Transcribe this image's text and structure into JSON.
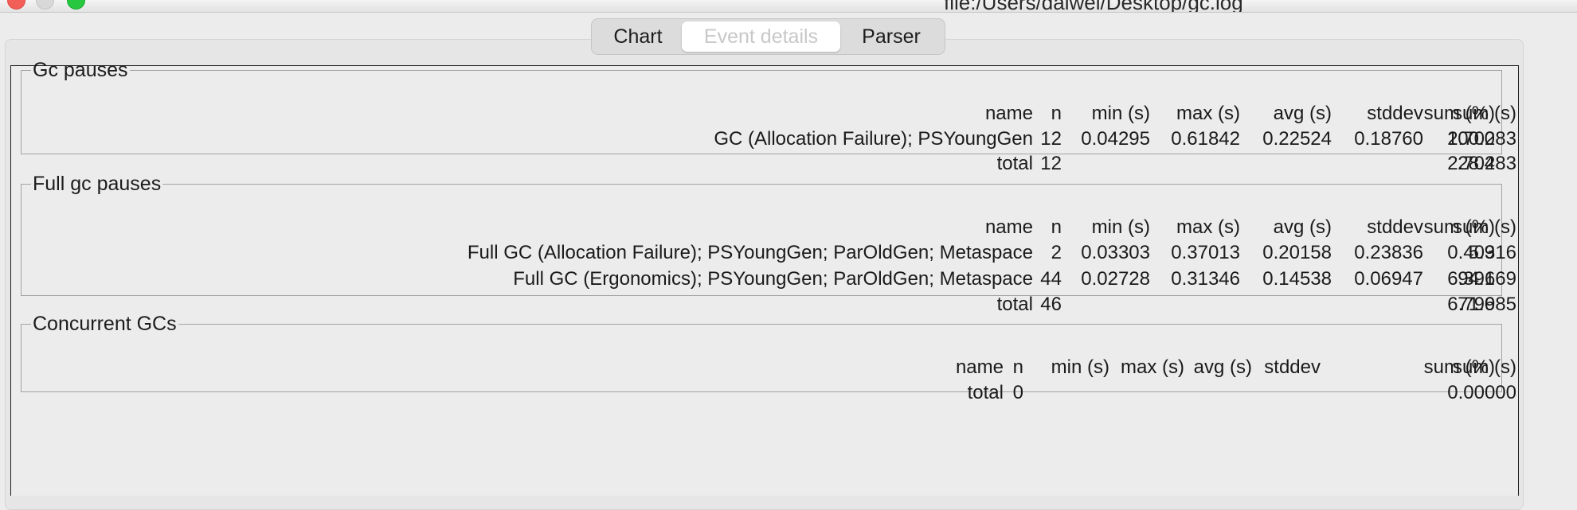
{
  "window": {
    "title": "file:/Users/daiwei/Desktop/gc.log"
  },
  "tabs": [
    "Chart",
    "Event details",
    "Parser"
  ],
  "selected_tab": "Event details",
  "columns": [
    "name",
    "n",
    "min (s)",
    "max (s)",
    "avg (s)",
    "stddev",
    "sum (s)",
    "sum (%)"
  ],
  "gc_pauses": {
    "title": "Gc pauses",
    "rows": [
      {
        "name": "GC (Allocation Failure); PSYoungGen",
        "n": "12",
        "min": "0.04295",
        "max": "0.61842",
        "avg": "0.22524",
        "stddev": "0.18760",
        "sum": "2.70283",
        "pct": "100.0"
      }
    ],
    "total": {
      "name": "total",
      "n": "12",
      "sum": "2.70283",
      "pct": "28.4"
    }
  },
  "full_gc_pauses": {
    "title": "Full gc pauses",
    "rows": [
      {
        "name": "Full GC (Allocation Failure); PSYoungGen; ParOldGen; Metaspace",
        "n": "2",
        "min": "0.03303",
        "max": "0.37013",
        "avg": "0.20158",
        "stddev": "0.23836",
        "sum": "0.40316",
        "pct": "5.9"
      },
      {
        "name": "Full GC (Ergonomics); PSYoungGen; ParOldGen; Metaspace",
        "n": "44",
        "min": "0.02728",
        "max": "0.31346",
        "avg": "0.14538",
        "stddev": "0.06947",
        "sum": "6.39669",
        "pct": "94.1"
      }
    ],
    "total": {
      "name": "total",
      "n": "46",
      "sum": "6.79985",
      "pct": "71.6"
    }
  },
  "concurrent_gcs": {
    "title": "Concurrent GCs",
    "total": {
      "name": "total",
      "n": "0",
      "sum": "0.00000"
    }
  }
}
